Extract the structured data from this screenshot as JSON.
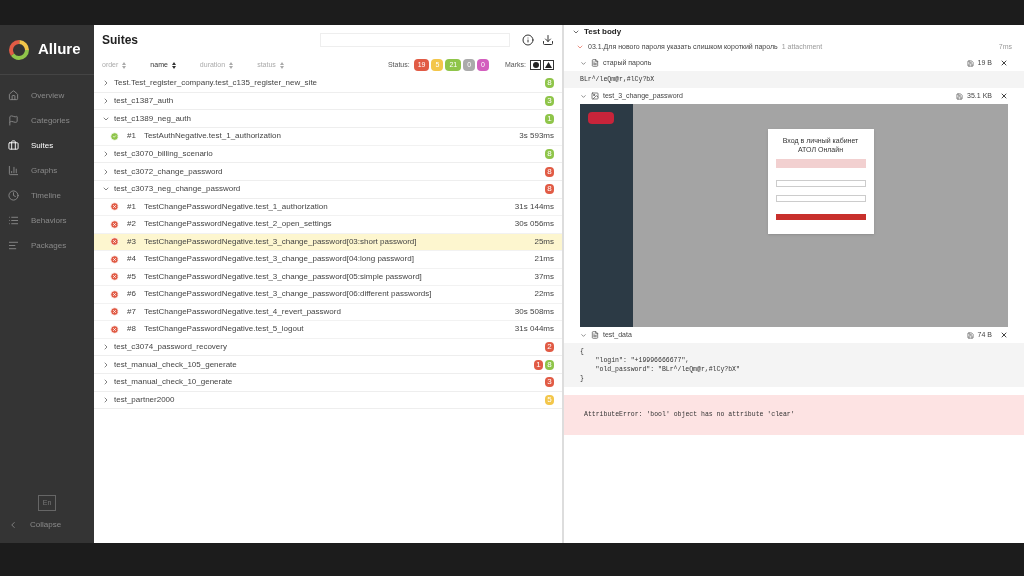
{
  "sidebar": {
    "brand": "Allure",
    "items": [
      {
        "label": "Overview",
        "selected": false
      },
      {
        "label": "Categories",
        "selected": false
      },
      {
        "label": "Suites",
        "selected": true
      },
      {
        "label": "Graphs",
        "selected": false
      },
      {
        "label": "Timeline",
        "selected": false
      },
      {
        "label": "Behaviors",
        "selected": false
      },
      {
        "label": "Packages",
        "selected": false
      }
    ],
    "language": "En",
    "collapse": "Collapse"
  },
  "suites": {
    "title": "Suites",
    "sorts": [
      {
        "label": "order",
        "selected": false
      },
      {
        "label": "name",
        "selected": true
      },
      {
        "label": "duration",
        "selected": false
      },
      {
        "label": "status",
        "selected": false
      }
    ],
    "status_label": "Status:",
    "status_counts": [
      {
        "count": "19",
        "color": "#e15b45"
      },
      {
        "count": "5",
        "color": "#f3c64a"
      },
      {
        "count": "21",
        "color": "#8fc54a"
      },
      {
        "count": "0",
        "color": "#aaaaaa"
      },
      {
        "count": "0",
        "color": "#d35ebe"
      }
    ],
    "marks_label": "Marks:",
    "groups": [
      {
        "name": "Test.Test_register_company.test_c135_register_new_site",
        "expanded": false,
        "badges": [
          {
            "count": "8",
            "color": "#8fc54a"
          }
        ]
      },
      {
        "name": "test_c1387_auth",
        "expanded": false,
        "badges": [
          {
            "count": "3",
            "color": "#8fc54a"
          }
        ]
      },
      {
        "name": "test_c1389_neg_auth",
        "expanded": true,
        "badges": [
          {
            "count": "1",
            "color": "#8fc54a"
          }
        ],
        "tests": [
          {
            "num": "#1",
            "name": "TestAuthNegative.test_1_authorization",
            "duration": "3s 593ms",
            "passed": true,
            "selected": false
          }
        ]
      },
      {
        "name": "test_c3070_billing_scenario",
        "expanded": false,
        "badges": [
          {
            "count": "8",
            "color": "#8fc54a"
          }
        ]
      },
      {
        "name": "test_c3072_change_password",
        "expanded": false,
        "badges": [
          {
            "count": "8",
            "color": "#e15b45"
          }
        ]
      },
      {
        "name": "test_c3073_neg_change_password",
        "expanded": true,
        "badges": [
          {
            "count": "8",
            "color": "#e15b45"
          }
        ],
        "tests": [
          {
            "num": "#1",
            "name": "TestChangePasswordNegative.test_1_authorization",
            "duration": "31s 144ms",
            "passed": false,
            "selected": false
          },
          {
            "num": "#2",
            "name": "TestChangePasswordNegative.test_2_open_settings",
            "duration": "30s 056ms",
            "passed": false,
            "selected": false
          },
          {
            "num": "#3",
            "name": "TestChangePasswordNegative.test_3_change_password[03:short password]",
            "duration": "25ms",
            "passed": false,
            "selected": true
          },
          {
            "num": "#4",
            "name": "TestChangePasswordNegative.test_3_change_password[04:long password]",
            "duration": "21ms",
            "passed": false,
            "selected": false
          },
          {
            "num": "#5",
            "name": "TestChangePasswordNegative.test_3_change_password[05:simple password]",
            "duration": "37ms",
            "passed": false,
            "selected": false
          },
          {
            "num": "#6",
            "name": "TestChangePasswordNegative.test_3_change_password[06:different passwords]",
            "duration": "22ms",
            "passed": false,
            "selected": false
          },
          {
            "num": "#7",
            "name": "TestChangePasswordNegative.test_4_revert_password",
            "duration": "30s 508ms",
            "passed": false,
            "selected": false
          },
          {
            "num": "#8",
            "name": "TestChangePasswordNegative.test_5_logout",
            "duration": "31s 044ms",
            "passed": false,
            "selected": false
          }
        ]
      },
      {
        "name": "test_c3074_password_recovery",
        "expanded": false,
        "badges": [
          {
            "count": "2",
            "color": "#e15b45"
          }
        ]
      },
      {
        "name": "test_manual_check_105_generate",
        "expanded": false,
        "badges": [
          {
            "count": "1",
            "color": "#e15b45"
          },
          {
            "count": "8",
            "color": "#8fc54a"
          }
        ]
      },
      {
        "name": "test_manual_check_10_generate",
        "expanded": false,
        "badges": [
          {
            "count": "3",
            "color": "#e15b45"
          }
        ]
      },
      {
        "name": "test_partner2000",
        "expanded": false,
        "badges": [
          {
            "count": "5",
            "color": "#f3c64a"
          }
        ]
      }
    ]
  },
  "detail": {
    "section_title": "Test body",
    "step": {
      "title": "03.1.Для нового пароля указать слишком короткий пароль",
      "note": "1 attachment",
      "duration": "7ms"
    },
    "attachments": [
      {
        "kind": "text",
        "name": "старый пароль",
        "size": "19 B",
        "lines": [
          "BLr^/leQm@r,#lCy?bX"
        ]
      },
      {
        "kind": "image",
        "name": "test_3_change_password",
        "size": "35.1 KB",
        "screen_title": "Вход в личный кабинет АТОЛ Онлайн"
      },
      {
        "kind": "text",
        "name": "test_data",
        "size": "74 B",
        "lines": [
          "{",
          "    \"login\": \"+19996666677\",",
          "    \"old_password\": \"BLr^/leQm@r,#lCy?bX\"",
          "}"
        ]
      }
    ],
    "error": "AttributeError: 'bool' object has no attribute 'clear'"
  }
}
